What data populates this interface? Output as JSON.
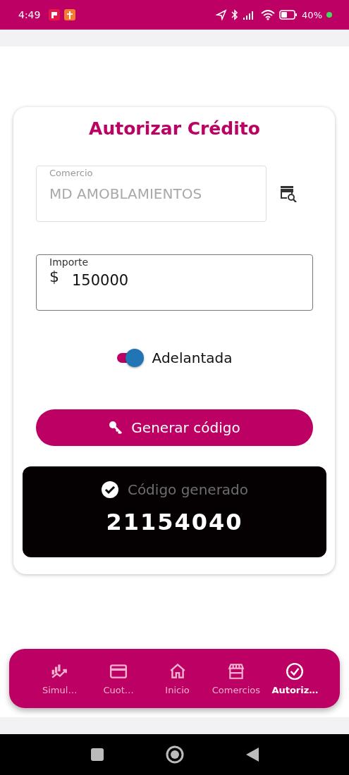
{
  "status_bar": {
    "time": "4:49",
    "battery": "40%"
  },
  "card": {
    "title": "Autorizar Crédito",
    "comercio": {
      "label": "Comercio",
      "value": "MD AMOBLAMIENTOS",
      "disabled": true
    },
    "importe": {
      "label": "Importe",
      "prefix": "$",
      "value": "150000"
    },
    "toggle": {
      "label": "Adelantada",
      "on": true
    },
    "button": "Generar código",
    "result": {
      "label": "Código generado",
      "code": "21154040"
    }
  },
  "nav": [
    {
      "label": "Simul…",
      "selected": false
    },
    {
      "label": "Cuot…",
      "selected": false
    },
    {
      "label": "Inicio",
      "selected": false
    },
    {
      "label": "Comercios",
      "selected": false
    },
    {
      "label": "Autoriz…",
      "selected": true
    }
  ]
}
